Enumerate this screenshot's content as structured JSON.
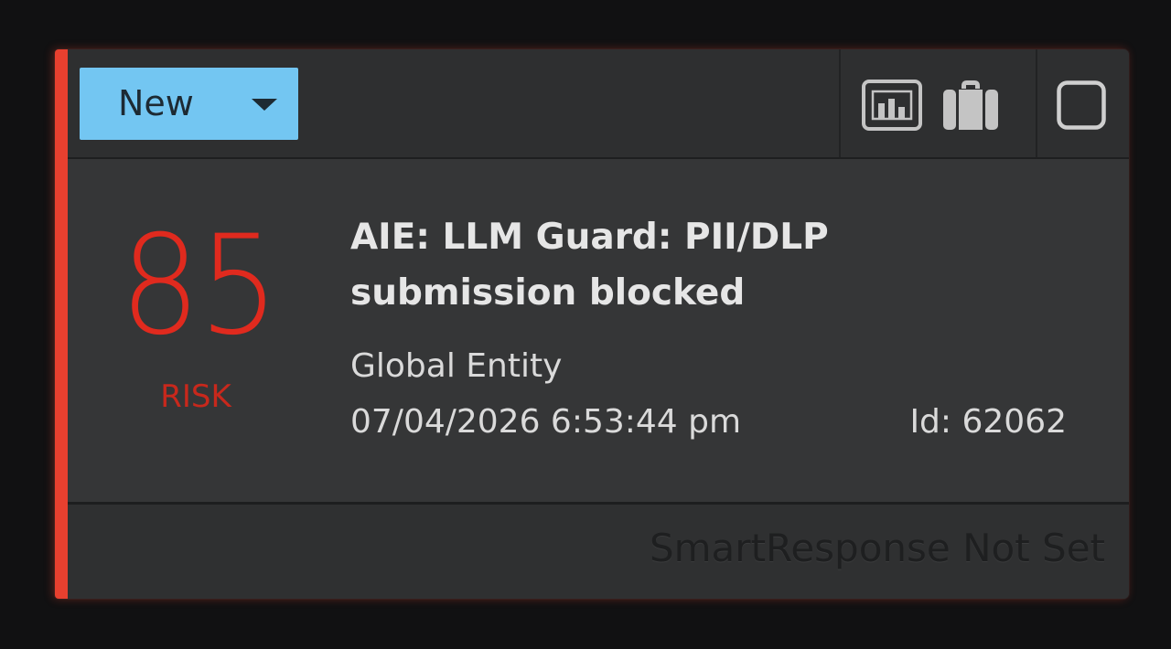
{
  "alarm_card": {
    "status": {
      "label": "New"
    },
    "risk": {
      "score": "85",
      "label": "RISK"
    },
    "title": "AIE: LLM Guard: PII/DLP submission blocked",
    "entity": "Global Entity",
    "timestamp": "07/04/2026 6:53:44 pm",
    "id_text": "Id: 62062",
    "smart_response": "SmartResponse Not Set"
  },
  "icons": {
    "chart": "bar-chart-icon",
    "case": "briefcase-icon",
    "select": "checkbox-icon"
  },
  "colors": {
    "accent": "#e8402f",
    "risk": "#e02a1e",
    "status_bg": "#73c6f2",
    "card_bg": "#353637"
  }
}
